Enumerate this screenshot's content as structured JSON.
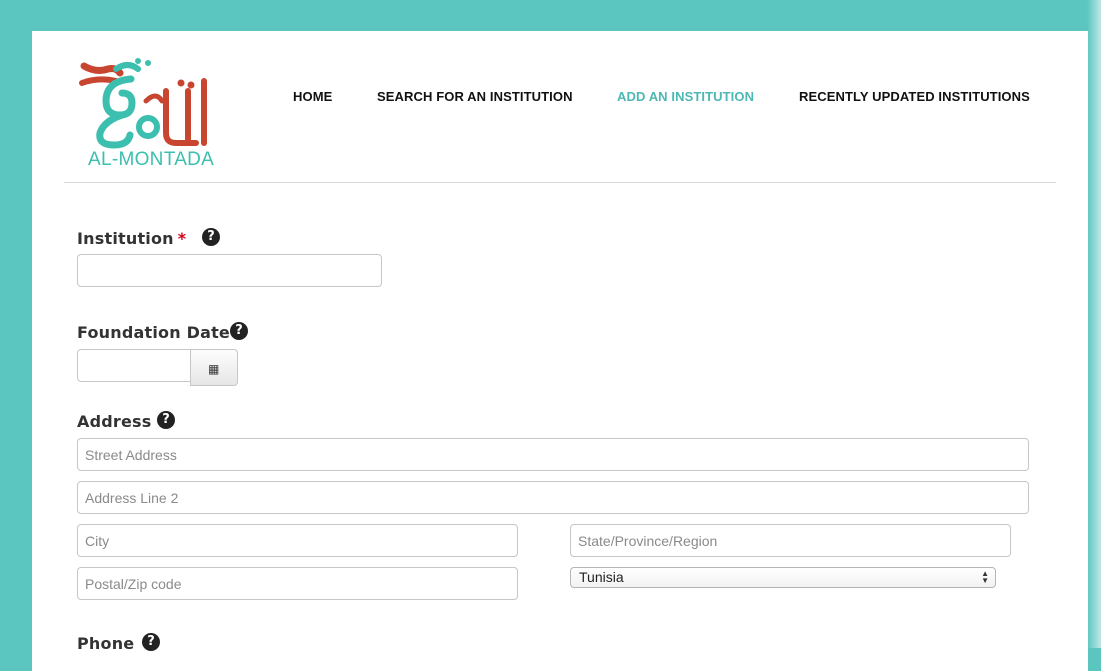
{
  "brand": {
    "logo_text": "AL-MONTADA",
    "colors": {
      "red": "#c8452f",
      "teal": "#3cbfae"
    }
  },
  "nav": {
    "items": [
      {
        "label": "HOME",
        "active": false
      },
      {
        "label": "SEARCH FOR AN INSTITUTION",
        "active": false
      },
      {
        "label": "ADD AN INSTITUTION",
        "active": true
      },
      {
        "label": "RECENTLY UPDATED INSTITUTIONS",
        "active": false
      }
    ]
  },
  "form": {
    "institution": {
      "label": "Institution",
      "required_mark": "*",
      "help": "?",
      "value": ""
    },
    "foundation_date": {
      "label": "Foundation Date",
      "help": "?",
      "value": "",
      "calendar_icon": "calendar-icon"
    },
    "address": {
      "label": "Address",
      "help": "?",
      "street_placeholder": "Street Address",
      "line2_placeholder": "Address Line 2",
      "city_placeholder": "City",
      "state_placeholder": "State/Province/Region",
      "zip_placeholder": "Postal/Zip code",
      "country_selected": "Tunisia"
    },
    "phone": {
      "label": "Phone",
      "help": "?"
    }
  }
}
